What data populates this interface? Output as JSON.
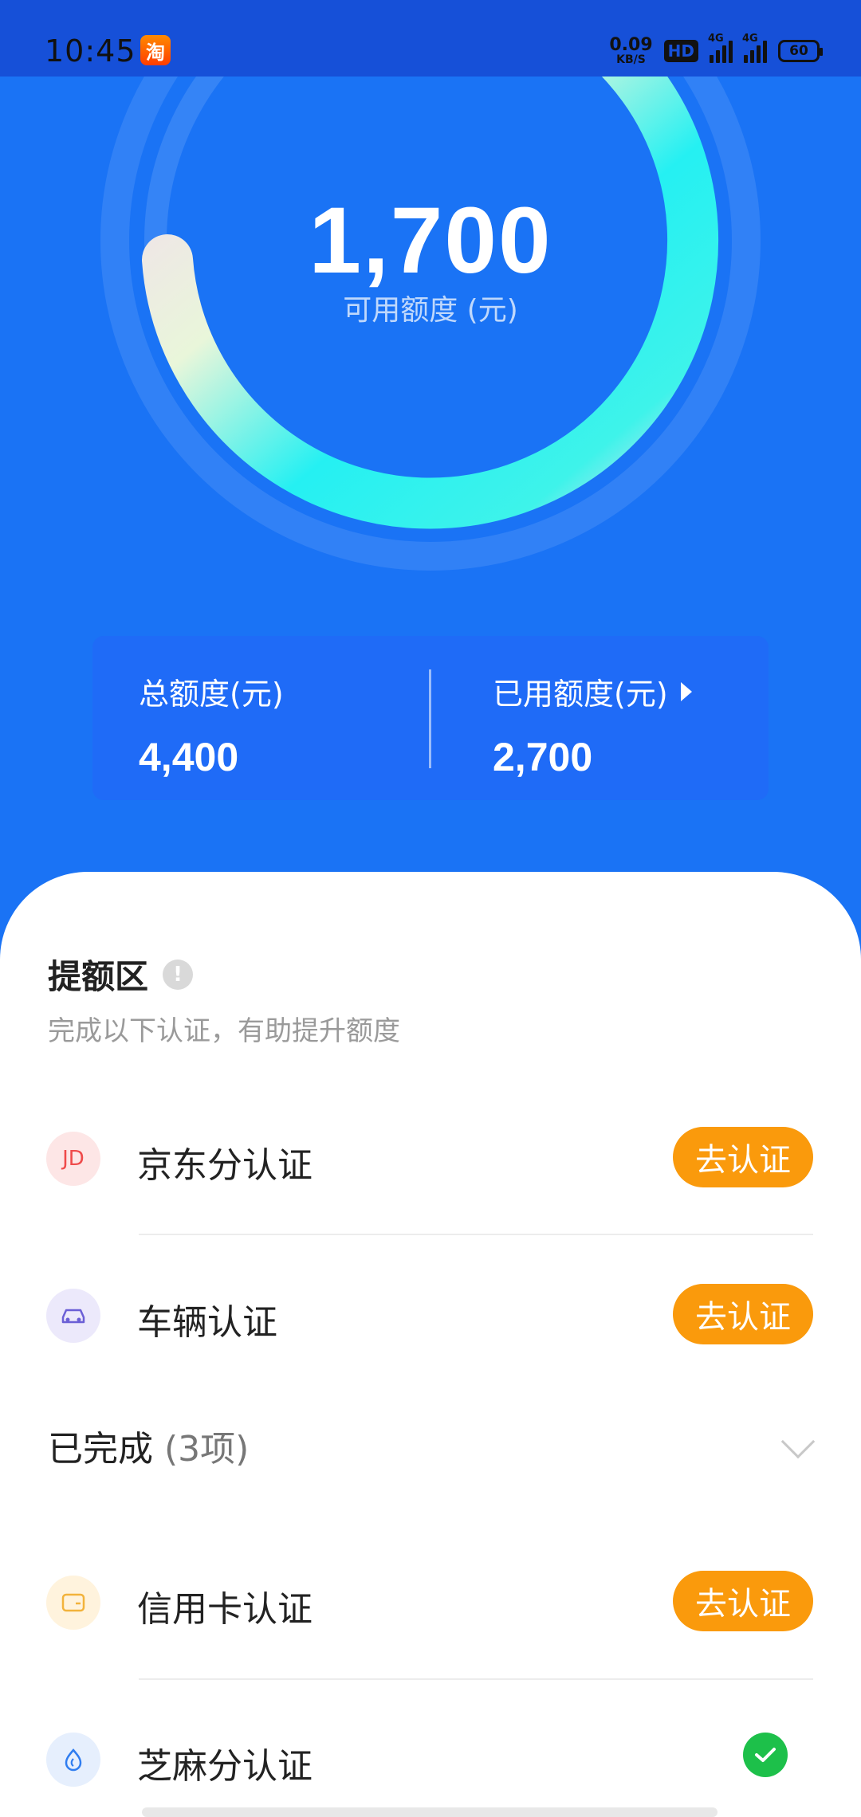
{
  "status_bar": {
    "time": "10:45",
    "app_icon_glyph": "淘",
    "net_speed_value": "0.09",
    "net_speed_unit": "KB/S",
    "hd_label": "HD",
    "signal1_tag": "4G",
    "signal2_tag": "4G",
    "battery": "60"
  },
  "credit": {
    "available_amount": "1,700",
    "available_label": "可用额度 (元)",
    "total_label": "总额度(元)",
    "total_value": "4,400",
    "used_label": "已用额度(元)",
    "used_value": "2,700"
  },
  "boost": {
    "title": "提额区",
    "subtitle": "完成以下认证，有助提升额度",
    "items": [
      {
        "label": "京东分认证",
        "icon": "jd-icon",
        "icon_text": "JD",
        "button": "去认证"
      },
      {
        "label": "车辆认证",
        "icon": "car-icon",
        "button": "去认证"
      }
    ]
  },
  "completed": {
    "title": "已完成",
    "count": "(3项)",
    "items": [
      {
        "label": "信用卡认证",
        "icon": "wallet-icon",
        "button": "去认证"
      },
      {
        "label": "芝麻分认证",
        "icon": "sesame-icon",
        "status": "check-icon"
      }
    ]
  },
  "colors": {
    "primary_blue": "#1a73f5",
    "status_bar_blue": "#1650d8",
    "button_orange": "#fa9a0c",
    "success_green": "#1dc04a"
  }
}
